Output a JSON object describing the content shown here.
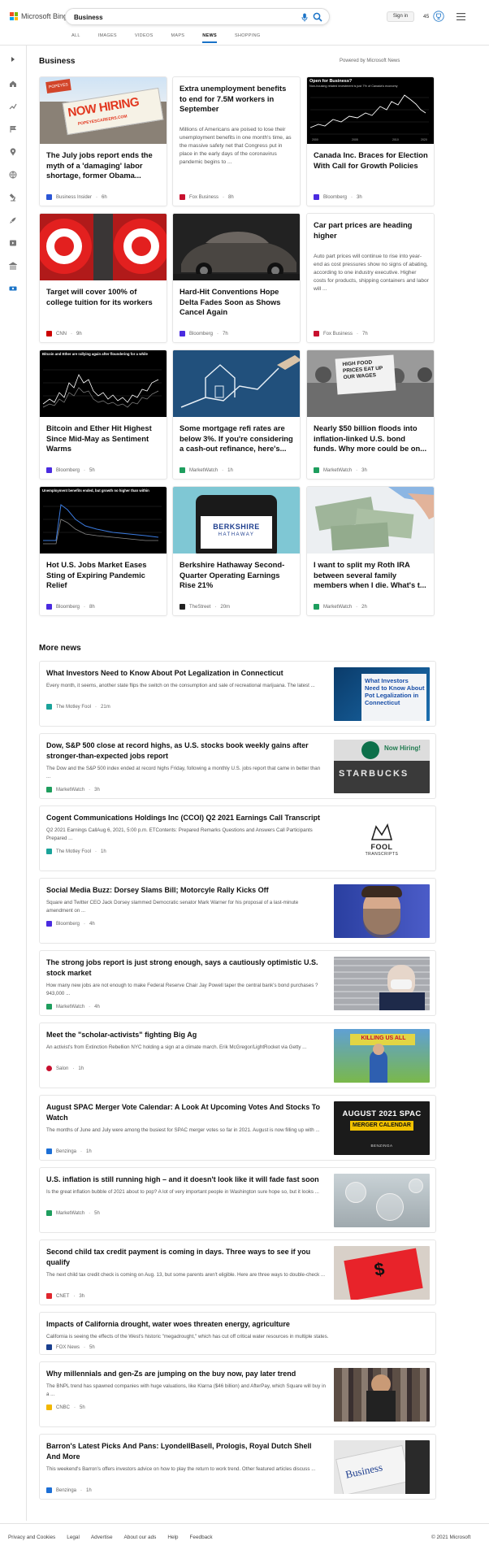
{
  "header": {
    "brand": "Microsoft Bing",
    "search_value": "Business",
    "nav": [
      "ALL",
      "IMAGES",
      "VIDEOS",
      "MAPS",
      "NEWS",
      "SHOPPING"
    ],
    "active_nav": "NEWS",
    "signin_label": "Sign in",
    "points": "45"
  },
  "section": {
    "title": "Business",
    "powered_by": "Powered by Microsoft News"
  },
  "cards": [
    {
      "title": "The July jobs report ends the myth of a 'damaging' labor shortage, former Obama...",
      "source": "Business Insider",
      "time": "6h",
      "image_text": "NOW HIRING",
      "image_subtext": "POPEYESCAREERS.COM",
      "logo_color": "#2b56d6"
    },
    {
      "title": "Extra unemployment benefits to end for 7.5M workers in September",
      "desc": "Millions of Americans are poised to lose their unemployment benefits in one month's time, as the massive safety net that Congress put in place in the early days of the coronavirus pandemic begins to ...",
      "source": "Fox Business",
      "time": "8h",
      "logo_color": "#c8102e"
    },
    {
      "title": "Canada Inc. Braces for Election With Call for Growth Policies",
      "source": "Bloomberg",
      "time": "3h",
      "image_text": "Open for Business?",
      "image_subtext": "Non-housing related investment is just 7% of Canada's economy",
      "logo_color": "#4a2be0"
    },
    {
      "title": "Target will cover 100% of college tuition for its workers",
      "source": "CNN",
      "time": "9h",
      "logo_color": "#cc0000"
    },
    {
      "title": "Hard-Hit Conventions Hope Delta Fades Soon as Shows Cancel Again",
      "source": "Bloomberg",
      "time": "7h",
      "logo_color": "#4a2be0"
    },
    {
      "title": "Car part prices are heading higher",
      "desc": "Auto part prices will continue to rise into year-end as cost pressures show no signs of abating, according to one industry executive. Higher costs for products, shipping containers and labor will ...",
      "source": "Fox Business",
      "time": "7h",
      "logo_color": "#c8102e"
    },
    {
      "title": "Bitcoin and Ether Hit Highest Since Mid-May as Sentiment Warms",
      "source": "Bloomberg",
      "time": "5h",
      "image_text": "Bitcoin and Ether are rallying again after floundering for a while",
      "logo_color": "#4a2be0"
    },
    {
      "title": "Some mortgage refi rates are below 3%. If you're considering a cash-out refinance, here's...",
      "source": "MarketWatch",
      "time": "1h",
      "logo_color": "#1e9e5e"
    },
    {
      "title": "Nearly $50 billion floods into inflation-linked U.S. bond funds. Why more could be on...",
      "source": "MarketWatch",
      "time": "3h",
      "image_text": "HIGH FOOD PRICES EAT UP OUR WAGES",
      "logo_color": "#1e9e5e"
    },
    {
      "title": "Hot U.S. Jobs Market Eases Sting of Expiring Pandemic Relief",
      "source": "Bloomberg",
      "time": "8h",
      "image_text": "Unemployment benefits ended, but growth no higher than within",
      "logo_color": "#4a2be0"
    },
    {
      "title": "Berkshire Hathaway Second-Quarter Operating Earnings Rise 21%",
      "source": "TheStreet",
      "time": "20m",
      "image_text": "BERKSHIRE",
      "image_subtext": "HATHAWAY",
      "logo_color": "#222222"
    },
    {
      "title": "I want to split my Roth IRA between several family members when I die. What's t...",
      "source": "MarketWatch",
      "time": "2h",
      "logo_color": "#1e9e5e"
    }
  ],
  "more": {
    "title": "More news",
    "items": [
      {
        "title": "What Investors Need to Know About Pot Legalization in Connecticut",
        "desc": "Every month, it seems, another state flips the switch on the consumption and sale of recreational marijuana. The latest ...",
        "source": "The Motley Fool",
        "time": "21m",
        "image_text": "What Investors Need to Know About Pot Legalization in Connecticut",
        "logo_color": "#1aa39a"
      },
      {
        "title": "Dow, S&P 500 close at record highs, as U.S. stocks book weekly gains after stronger-than-expected jobs report",
        "desc": "The Dow and the S&P 500 index ended at record highs Friday, following a monthly U.S. jobs report that came in better than ...",
        "source": "MarketWatch",
        "time": "3h",
        "image_text": "Now Hiring!",
        "image_subtext": "STARBUCKS",
        "logo_color": "#1e9e5e"
      },
      {
        "title": "Cogent Communications Holdings Inc (CCOI) Q2 2021 Earnings Call Transcript",
        "desc": "Q2 2021 Earnings CallAug 6, 2021, 5:00 p.m. ETContents: Prepared Remarks Questions and Answers Call Participants Prepared ...",
        "source": "The Motley Fool",
        "time": "1h",
        "image_text": "FOOL",
        "image_subtext": "TRANSCRIPTS",
        "logo_color": "#1aa39a"
      },
      {
        "title": "Social Media Buzz: Dorsey Slams Bill; Motorcyle Rally Kicks Off",
        "desc": "Square and Twitter CEO Jack Dorsey slammed Democratic senator Mark Warner for his proposal of a last-minute amendment on ...",
        "source": "Bloomberg",
        "time": "4h",
        "logo_color": "#4a2be0"
      },
      {
        "title": "The strong jobs report is just strong enough, says a cautiously optimistic U.S. stock market",
        "desc": "How many new jobs are not enough to make Federal Reserve Chair Jay Powell taper the central bank's bond purchases ? 943,000 ...",
        "source": "MarketWatch",
        "time": "4h",
        "logo_color": "#1e9e5e"
      },
      {
        "title": "Meet the \"scholar-activists\" fighting Big Ag",
        "desc": "An activist's from Extinction Rebellion NYC holding a sign at a climate march. Erik McGregor/LightRocket via Getty ...",
        "source": "Salon",
        "time": "1h",
        "image_text": "KILLING US ALL",
        "logo_color": "#c8102e"
      },
      {
        "title": "August SPAC Merger Vote Calendar: A Look At Upcoming Votes And Stocks To Watch",
        "desc": "The months of June and July were among the busiest for SPAC merger votes so far in 2021. August is now filling up with ...",
        "source": "Benzinga",
        "time": "1h",
        "image_text": "AUGUST 2021 SPAC",
        "image_subtext": "MERGER CALENDAR",
        "image_brand": "BENZINGA",
        "logo_color": "#1c6fd6"
      },
      {
        "title": "U.S. inflation is still running high – and it doesn't look like it will fade fast soon",
        "desc": "Is the great inflation bubble of 2021 about to pop? A lot of very important people in Washington sure hope so, but it looks ...",
        "source": "MarketWatch",
        "time": "5h",
        "logo_color": "#1e9e5e"
      },
      {
        "title": "Second child tax credit payment is coming in days. Three ways to see if you qualify",
        "desc": "The next child tax credit check is coming on Aug. 13, but some parents aren't eligible. Here are three ways to double-check ...",
        "source": "CNET",
        "time": "3h",
        "logo_color": "#e0262d"
      },
      {
        "title": "Impacts of California drought, water woes threaten energy, agriculture",
        "desc": "California is seeing the effects of the West's historic \"megadrought,\" which has cut off critical water resources in multiple states.",
        "source": "FOX News",
        "time": "5h",
        "logo_color": "#1a3f8f"
      },
      {
        "title": "Why millennials and gen-Zs are jumping on the buy now, pay later trend",
        "desc": "The BNPL trend has spawned companies with huge valuations, like Klarna ($46 billion) and AfterPay, which Square will buy in a ...",
        "source": "CNBC",
        "time": "5h",
        "logo_color": "#f2b700"
      },
      {
        "title": "Barron's Latest Picks And Pans: LyondellBasell, Prologis, Royal Dutch Shell And More",
        "desc": "This weekend's Barron's offers investors advice on how to play the return to work trend. Other featured articles discuss ...",
        "source": "Benzinga",
        "time": "1h",
        "image_text": "Business",
        "logo_color": "#1c6fd6"
      }
    ]
  },
  "footer": {
    "links": [
      "Privacy and Cookies",
      "Legal",
      "Advertise",
      "About our ads",
      "Help",
      "Feedback"
    ],
    "copyright": "© 2021 Microsoft"
  },
  "colors": {
    "accent": "#1a73c7",
    "ms_red": "#f25022",
    "ms_green": "#7fba00",
    "ms_blue": "#00a4ef",
    "ms_yellow": "#ffb900"
  }
}
